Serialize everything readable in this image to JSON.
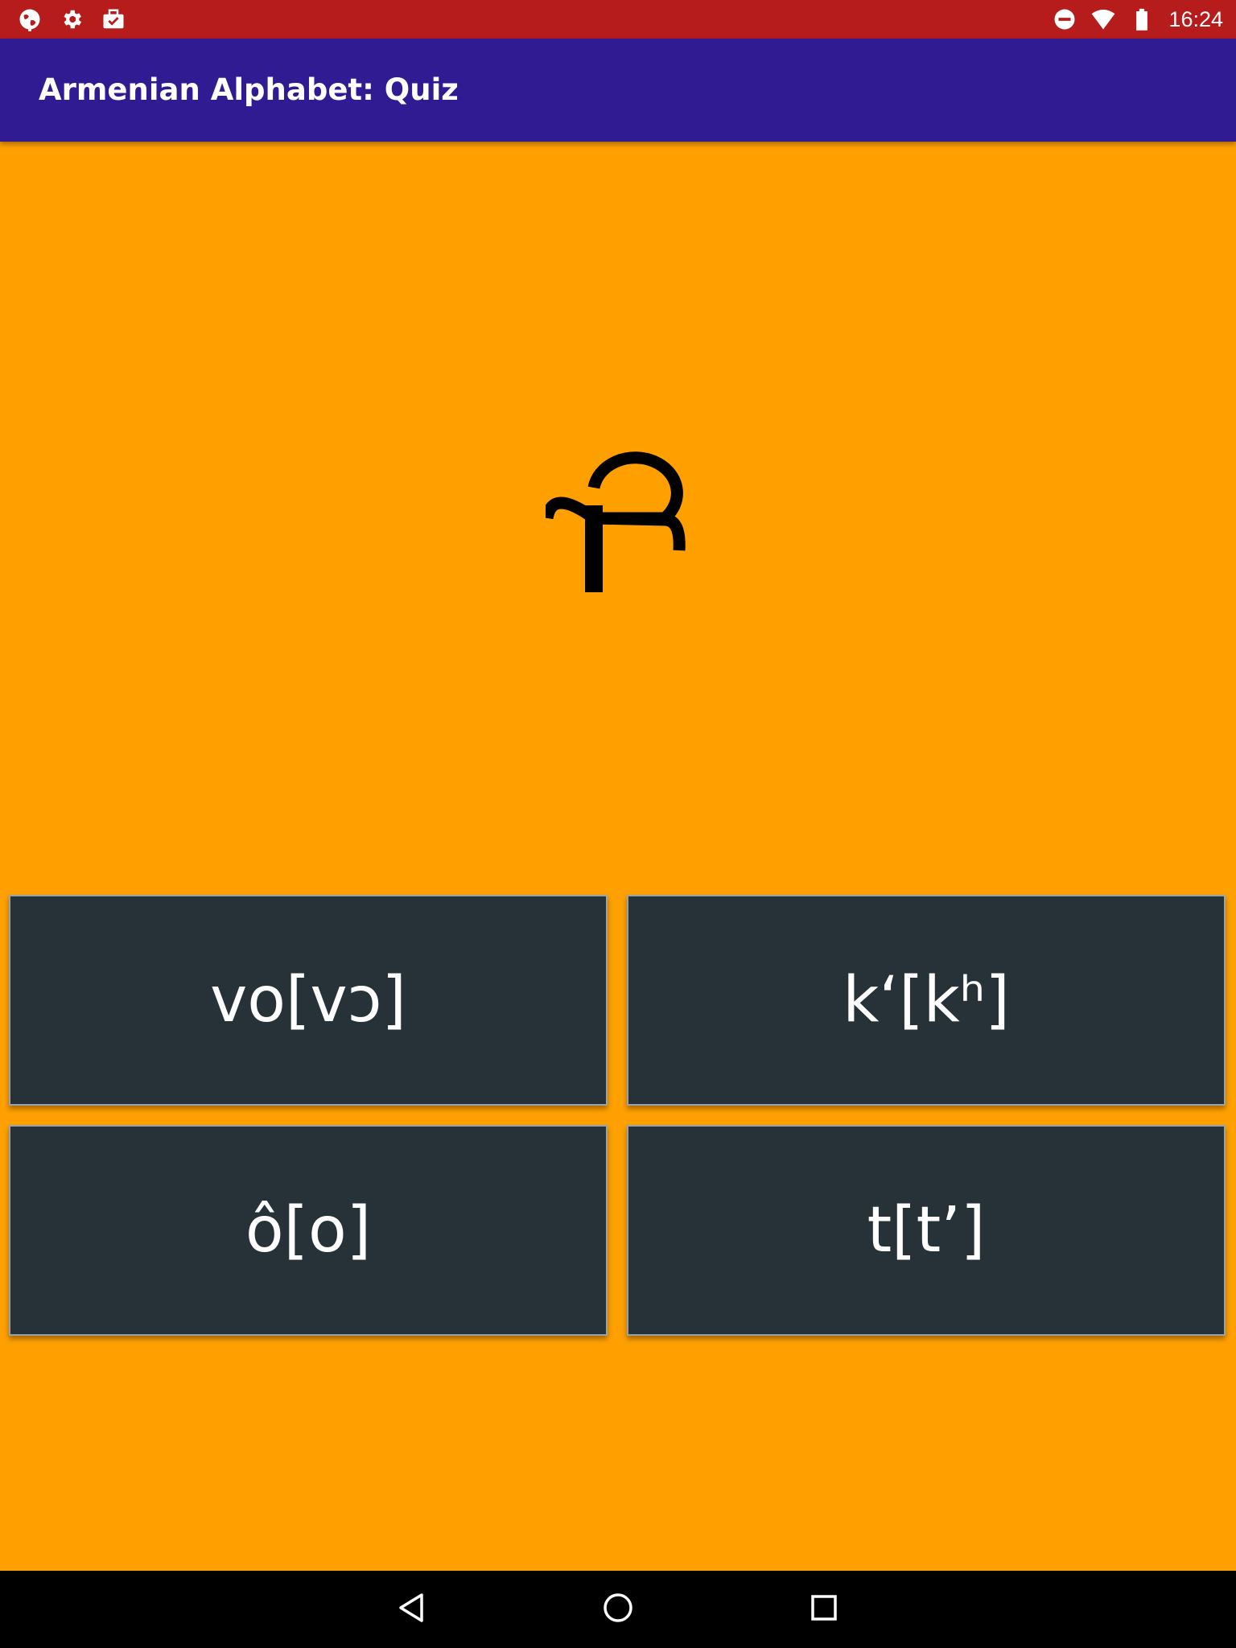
{
  "status_bar": {
    "left_icons": [
      "globe-icon",
      "settings-gear-icon",
      "briefcase-check-icon"
    ],
    "right_icons": [
      "do-not-disturb-icon",
      "wifi-icon",
      "battery-icon"
    ],
    "time": "16:24",
    "background": "#b71c1c"
  },
  "app_bar": {
    "title": "Armenian Alphabet: Quiz",
    "background": "#311b92"
  },
  "quiz": {
    "letter": "Ք",
    "background": "#ffa000",
    "answers": [
      {
        "text": "vo[vɔ]"
      },
      {
        "text": "k‘[kʰ]"
      },
      {
        "text": "ô[o]"
      },
      {
        "text": "t[t’]"
      }
    ],
    "answer_background": "#263238"
  },
  "nav_bar": {
    "icons": [
      "back-triangle-icon",
      "home-circle-icon",
      "recents-square-icon"
    ]
  }
}
